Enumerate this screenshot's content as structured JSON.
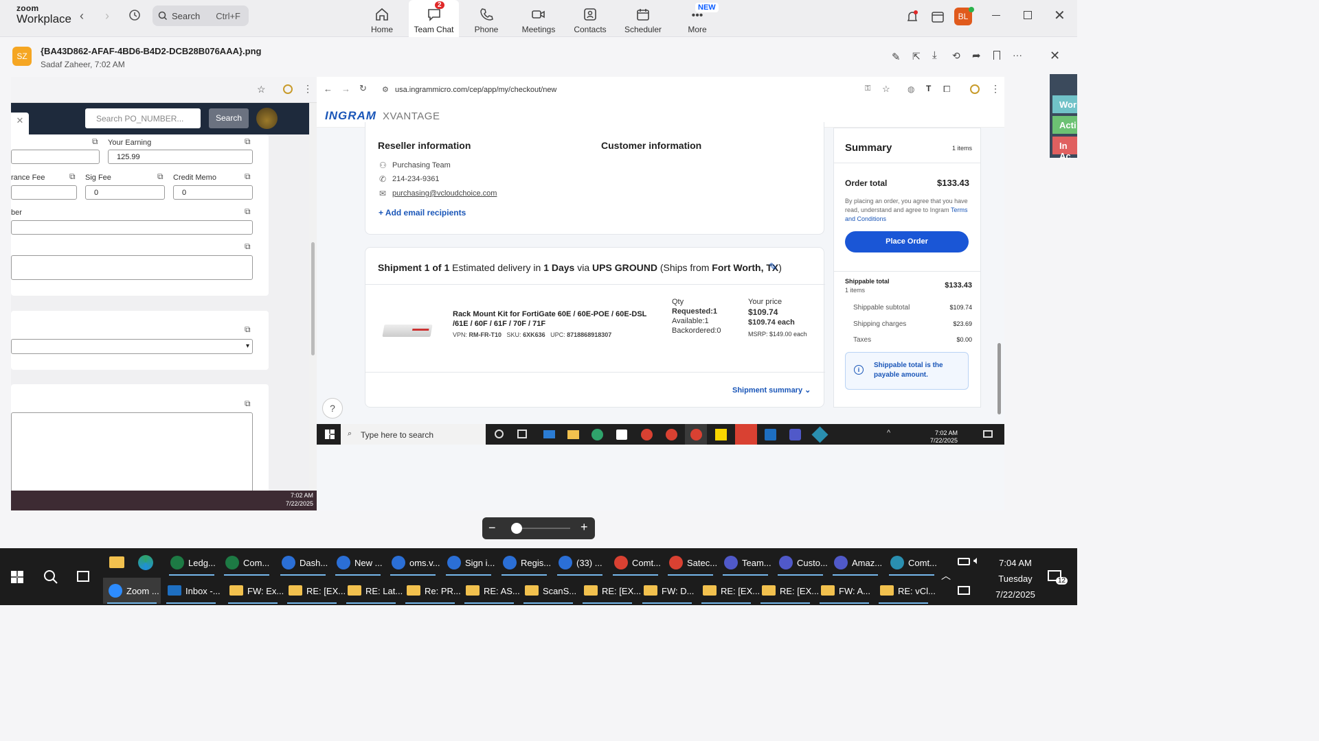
{
  "app": {
    "brand_top": "zoom",
    "brand_bottom": "Workplace",
    "search_placeholder": "Search",
    "search_shortcut": "Ctrl+F",
    "avatar_initials": "BL"
  },
  "tabs": [
    {
      "label": "Home"
    },
    {
      "label": "Team Chat",
      "badge": "2"
    },
    {
      "label": "Phone"
    },
    {
      "label": "Meetings"
    },
    {
      "label": "Contacts"
    },
    {
      "label": "Scheduler"
    },
    {
      "label": "More",
      "tag": "NEW"
    }
  ],
  "message": {
    "avatar": "SZ",
    "filename": "{BA43D862-AFAF-4BD6-B4D2-DCB28B076AAA}.png",
    "sender_time": "Sadaf Zaheer, 7:02 AM"
  },
  "left_form": {
    "search_placeholder": "Search PO_NUMBER...",
    "search_button": "Search",
    "your_earning_label": "Your Earning",
    "your_earning_value": "125.99",
    "insurance_fee_label": "rance Fee",
    "sig_fee_label": "Sig Fee",
    "sig_fee_value": "0",
    "credit_memo_label": "Credit Memo",
    "credit_memo_value": "0",
    "number_label": "ber",
    "time": "7:02 AM",
    "date": "7/22/2025"
  },
  "browser": {
    "url": "usa.ingrammicro.com/cep/app/my/checkout/new"
  },
  "xvantage": {
    "brand": "INGRAM",
    "sub": "XVANTAGE"
  },
  "reseller": {
    "title": "Reseller information",
    "name": "Purchasing Team",
    "phone": "214-234-9361",
    "email": "purchasing@vcloudchoice.com",
    "add_recipients": "+ Add email recipients"
  },
  "customer": {
    "title": "Customer information"
  },
  "shipment": {
    "s1": "Shipment 1 of 1",
    "s2": " Estimated delivery in ",
    "s3": "1 Days",
    "s4": " via ",
    "s5": "UPS GROUND",
    "s6": " (Ships from ",
    "s7": "Fort Worth, TX",
    "s8": ")",
    "summary_link": "Shipment summary"
  },
  "product": {
    "name": "Rack Mount Kit for FortiGate 60E / 60E-POE / 60E-DSL /61E / 60F / 61F / 70F / 71F",
    "vpn_label": "VPN:",
    "vpn": "RM-FR-T10",
    "sku_label": "SKU:",
    "sku": "6XK636",
    "upc_label": "UPC:",
    "upc": "8718868918307",
    "qty_label": "Qty",
    "requested": "Requested:1",
    "available": "Available:1",
    "backordered": "Backordered:0",
    "price_label": "Your price",
    "price": "$109.74",
    "price_each": "$109.74 each",
    "msrp": "MSRP: $149.00 each"
  },
  "summary": {
    "title": "Summary",
    "items": "1 items",
    "order_total_label": "Order total",
    "order_total": "$133.43",
    "terms_pre": "By placing an order, you agree that you have read, understand and agree to Ingram ",
    "terms_link": "Terms and Conditions",
    "place_order": "Place Order",
    "shippable_total_label": "Shippable total",
    "shippable_items": "1 items",
    "shippable_total": "$133.43",
    "subtotal_label": "Shippable subtotal",
    "subtotal": "$109.74",
    "shipping_label": "Shipping charges",
    "shipping": "$23.69",
    "taxes_label": "Taxes",
    "taxes": "$0.00",
    "info": "Shippable total is the payable amount."
  },
  "inner_taskbar": {
    "search": "Type here to search",
    "time": "7:02 AM",
    "date": "7/22/2025"
  },
  "side_tags": [
    "Wor",
    "Acti",
    "In Ac"
  ],
  "windows_taskbar": {
    "row1": [
      {
        "label": "Ledg...",
        "color": "#1d7a44"
      },
      {
        "label": "Com...",
        "color": "#1d7a44"
      },
      {
        "label": "Dash...",
        "color": "#2b6fd6"
      },
      {
        "label": "New ...",
        "color": "#2b6fd6"
      },
      {
        "label": "oms.v...",
        "color": "#2b6fd6"
      },
      {
        "label": "Sign i...",
        "color": "#2b6fd6"
      },
      {
        "label": "Regis...",
        "color": "#2b6fd6"
      },
      {
        "label": "(33) ...",
        "color": "#2b6fd6"
      },
      {
        "label": "Comt...",
        "color": "#d94132"
      },
      {
        "label": "Satec...",
        "color": "#d94132"
      },
      {
        "label": "Team...",
        "color": "#5059c9"
      },
      {
        "label": "Custo...",
        "color": "#5059c9"
      },
      {
        "label": "Amaz...",
        "color": "#5059c9"
      },
      {
        "label": "Comt...",
        "color": "#2a8fb0"
      }
    ],
    "row2": [
      {
        "label": "Zoom ..."
      },
      {
        "label": "Inbox -..."
      },
      {
        "label": "FW: Ex..."
      },
      {
        "label": "RE: [EX..."
      },
      {
        "label": "RE: Lat..."
      },
      {
        "label": "Re: PR..."
      },
      {
        "label": "RE: AS..."
      },
      {
        "label": "ScanS..."
      },
      {
        "label": "RE: [EX..."
      },
      {
        "label": "FW: D..."
      },
      {
        "label": "RE: [EX..."
      },
      {
        "label": "RE: [EX..."
      },
      {
        "label": "FW: A..."
      },
      {
        "label": "RE: vCl..."
      }
    ],
    "time": "7:04 AM",
    "day": "Tuesday",
    "date": "7/22/2025",
    "notif": "12"
  }
}
